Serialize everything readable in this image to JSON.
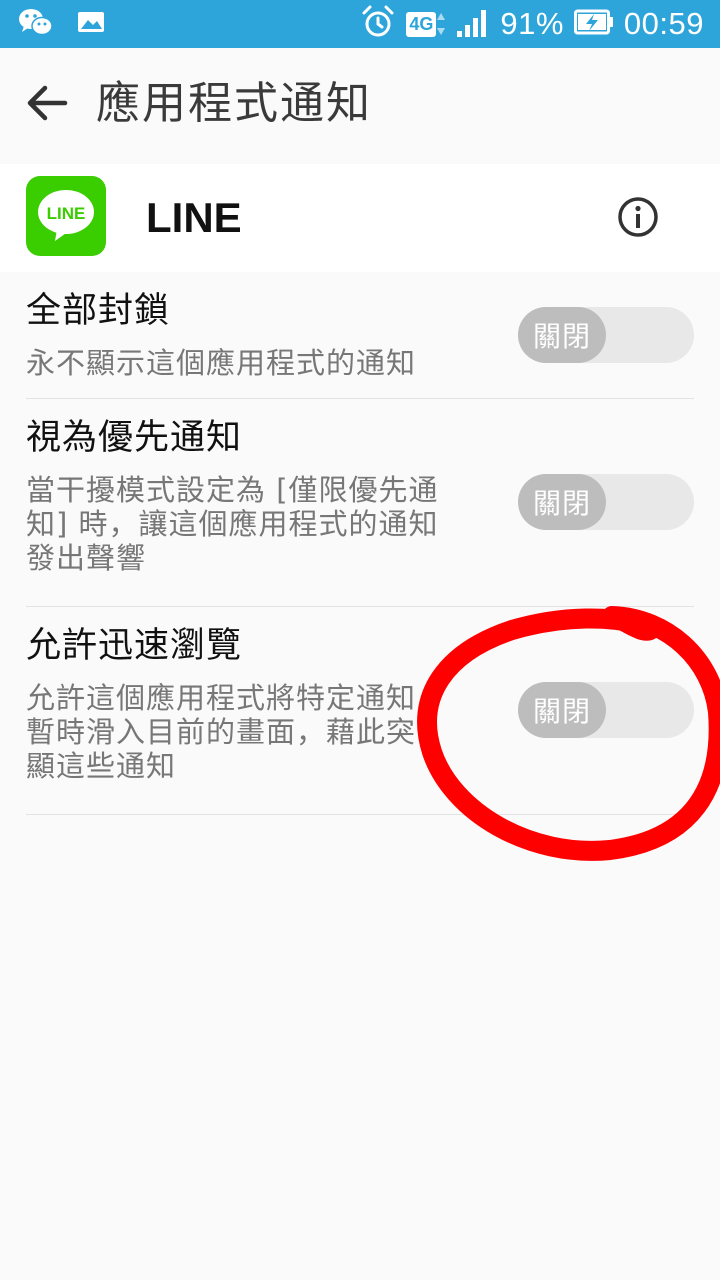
{
  "status_bar": {
    "network": "4G",
    "battery": "91%",
    "time": "00:59"
  },
  "header": {
    "title": "應用程式通知"
  },
  "app": {
    "name": "LINE",
    "logo_text": "LINE"
  },
  "settings": [
    {
      "title": "全部封鎖",
      "desc_lines": [
        "永不顯示這個應用程式的通知"
      ],
      "toggle_label": "關閉"
    },
    {
      "title": "視為優先通知",
      "desc_lines": [
        "當干擾模式設定為 [僅限優先通",
        "知] 時，讓這個應用程式的通知",
        "發出聲響"
      ],
      "toggle_label": "關閉"
    },
    {
      "title": "允許迅速瀏覽",
      "desc_lines": [
        "允許這個應用程式將特定通知",
        "暫時滑入目前的畫面，藉此突",
        "顯這些通知"
      ],
      "toggle_label": "關閉"
    }
  ],
  "colors": {
    "status_bar": "#2ea5da",
    "line_green": "#3acd00",
    "annotation_red": "#ff0000",
    "toggle_off": "#bdbdbd"
  }
}
